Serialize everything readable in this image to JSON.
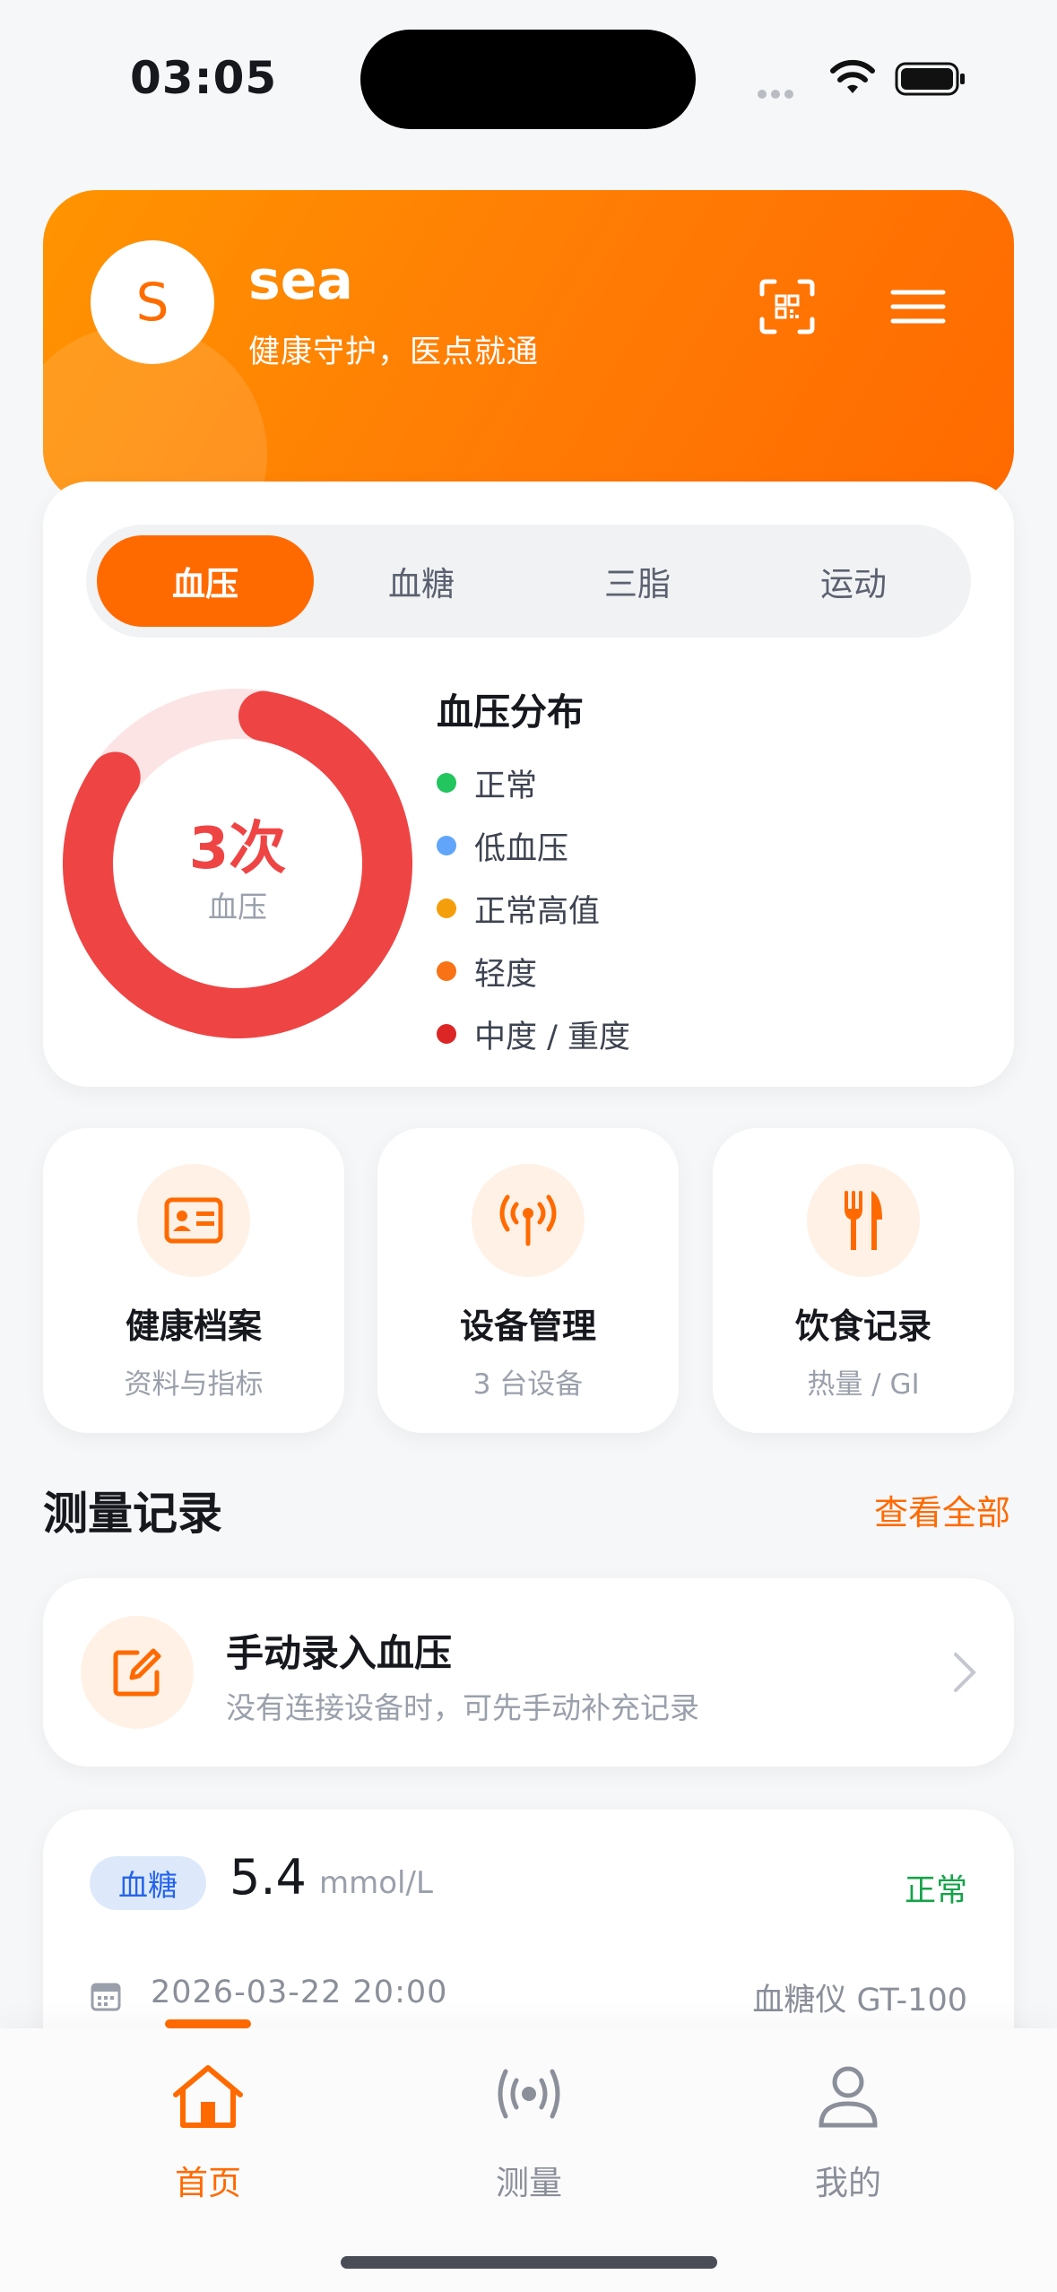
{
  "status_bar": {
    "time": "03:05"
  },
  "header": {
    "avatar_letter": "S",
    "username": "sea",
    "slogan": "健康守护，医点就通"
  },
  "tabs": [
    {
      "label": "血压",
      "active": true
    },
    {
      "label": "血糖",
      "active": false
    },
    {
      "label": "三脂",
      "active": false
    },
    {
      "label": "运动",
      "active": false
    }
  ],
  "distribution": {
    "title": "血压分布",
    "center_value": "3次",
    "center_label": "血压",
    "fill_fraction": 0.82,
    "legend": [
      {
        "label": "正常",
        "color": "#22c55e"
      },
      {
        "label": "低血压",
        "color": "#60a5fa"
      },
      {
        "label": "正常高值",
        "color": "#f59e0b"
      },
      {
        "label": "轻度",
        "color": "#f97316"
      },
      {
        "label": "中度 / 重度",
        "color": "#dc2626"
      }
    ]
  },
  "quick_actions": [
    {
      "title": "健康档案",
      "subtitle": "资料与指标",
      "icon": "id-card-icon"
    },
    {
      "title": "设备管理",
      "subtitle": "3 台设备",
      "icon": "antenna-icon"
    },
    {
      "title": "饮食记录",
      "subtitle": "热量 / GI",
      "icon": "utensils-icon"
    }
  ],
  "records": {
    "title": "测量记录",
    "view_all": "查看全部",
    "manual": {
      "title": "手动录入血压",
      "subtitle": "没有连接设备时，可先手动补充记录"
    },
    "items": [
      {
        "type": "血糖",
        "value": "5.4",
        "unit": "mmol/L",
        "status": "正常",
        "datetime": "2026-03-22 20:00",
        "device": "血糖仪 GT-100"
      }
    ]
  },
  "tabbar": [
    {
      "label": "首页",
      "active": true,
      "icon": "home-icon"
    },
    {
      "label": "测量",
      "active": false,
      "icon": "signal-icon"
    },
    {
      "label": "我的",
      "active": false,
      "icon": "user-icon"
    }
  ],
  "colors": {
    "accent": "#ff6a00",
    "danger": "#ef4444",
    "ok": "#16a34a"
  }
}
